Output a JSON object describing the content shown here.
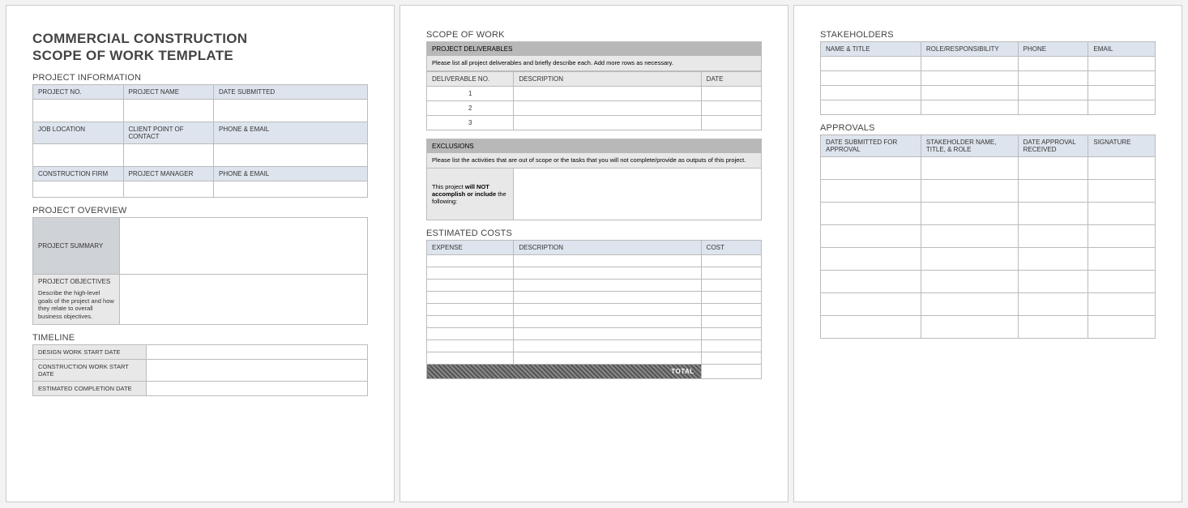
{
  "title_line1": "COMMERCIAL CONSTRUCTION",
  "title_line2": "SCOPE OF WORK TEMPLATE",
  "sections": {
    "projinfo": "PROJECT INFORMATION",
    "overview": "PROJECT OVERVIEW",
    "timeline": "TIMELINE",
    "scope": "SCOPE OF WORK",
    "estcosts": "ESTIMATED COSTS",
    "stakeholders": "STAKEHOLDERS",
    "approvals": "APPROVALS"
  },
  "projinfo": {
    "h1": "PROJECT NO.",
    "h2": "PROJECT NAME",
    "h3": "DATE SUBMITTED",
    "h4": "JOB LOCATION",
    "h5": "CLIENT POINT OF CONTACT",
    "h6": "PHONE & EMAIL",
    "h7": "CONSTRUCTION FIRM",
    "h8": "PROJECT MANAGER",
    "h9": "PHONE & EMAIL"
  },
  "overview": {
    "summary_label": "PROJECT SUMMARY",
    "objectives_label": "PROJECT OBJECTIVES",
    "objectives_note": "Describe the high-level goals of the project and how they relate to overall business objectives."
  },
  "timeline": {
    "r1": "DESIGN WORK START DATE",
    "r2": "CONSTRUCTION WORK START DATE",
    "r3": "ESTIMATED COMPLETION DATE"
  },
  "deliverables": {
    "banner": "PROJECT DELIVERABLES",
    "note": "Please list all project deliverables and briefly describe each. Add more rows as necessary.",
    "col1": "DELIVERABLE NO.",
    "col2": "DESCRIPTION",
    "col3": "DATE",
    "n1": "1",
    "n2": "2",
    "n3": "3"
  },
  "exclusions": {
    "banner": "EXCLUSIONS",
    "note": "Please list the activities that are out of scope or the tasks that you will not complete/provide as outputs of this project.",
    "side_pre": "This project ",
    "side_bold": "will NOT accomplish or include",
    "side_post": " the following:"
  },
  "costs": {
    "col1": "EXPENSE",
    "col2": "DESCRIPTION",
    "col3": "COST",
    "total": "TOTAL"
  },
  "stakeholders": {
    "col1": "NAME & TITLE",
    "col2": "ROLE/RESPONSIBILITY",
    "col3": "PHONE",
    "col4": "EMAIL"
  },
  "approvals": {
    "col1": "DATE SUBMITTED FOR APPROVAL",
    "col2": "STAKEHOLDER NAME, TITLE, & ROLE",
    "col3": "DATE APPROVAL RECEIVED",
    "col4": "SIGNATURE"
  }
}
